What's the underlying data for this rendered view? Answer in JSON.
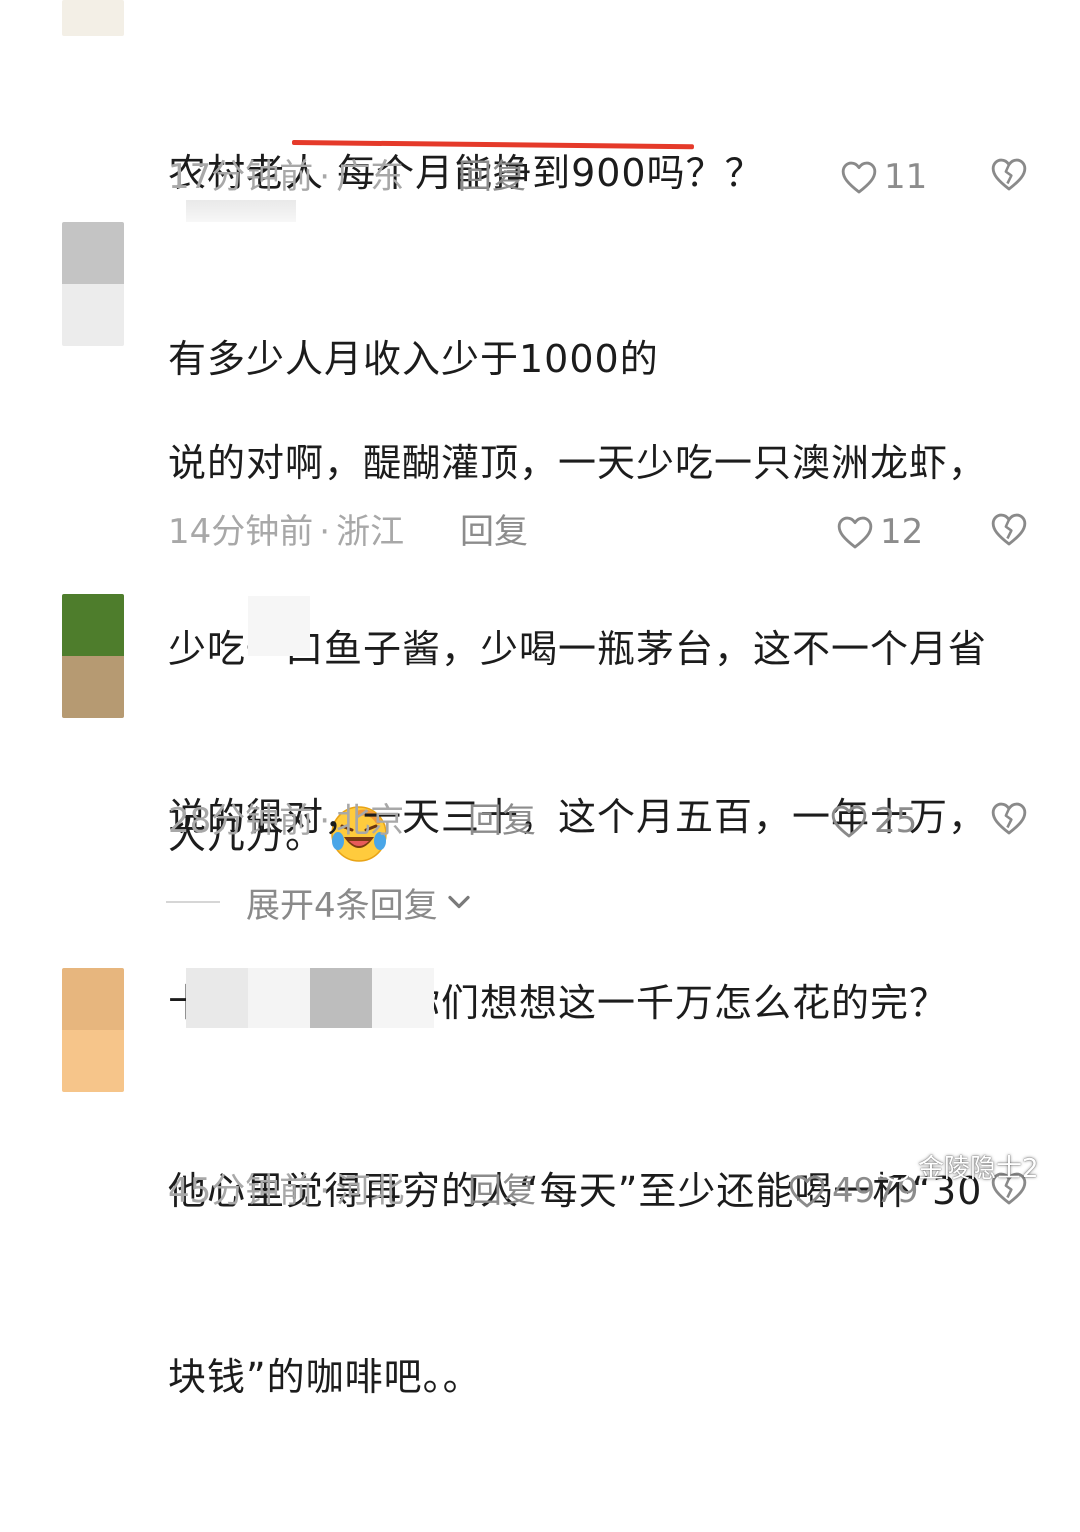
{
  "comments": [
    {
      "lines": [
        "农村老人 每个月能挣到900吗？？",
        "有多少人月收入少于1000的"
      ],
      "time": "17分钟前",
      "region": "广东",
      "reply_label": "回复",
      "likes": "11"
    },
    {
      "lines": [
        "说的对啊，醍醐灌顶，一天少吃一只澳洲龙虾，",
        "少吃一口鱼子酱，少喝一瓶茅台，这不一个月省",
        "大几万。"
      ],
      "emoji": "laughing-crying-emoji",
      "time": "14分钟前",
      "region": "浙江",
      "reply_label": "回复",
      "likes": "12"
    },
    {
      "lines": [
        "说的很对，一天三十，这个月五百，一年十万，",
        "十年一千万，你们想想这一千万怎么花的完？"
      ],
      "time": "28分钟前",
      "region": "北京",
      "reply_label": "回复",
      "likes": "25",
      "expand_label": "展开4条回复"
    },
    {
      "lines": [
        "他心里觉得再穷的人“每天”至少还能喝一杯“30",
        "块钱”的咖啡吧。。"
      ],
      "time": "45分钟前",
      "region": "河北",
      "reply_label": "回复",
      "likes": "4979"
    }
  ],
  "separator": "·",
  "watermark": "金陵隐士2",
  "colors": {
    "highlight_underline": "#e53a2a",
    "meta_text": "#a8a8a8"
  }
}
